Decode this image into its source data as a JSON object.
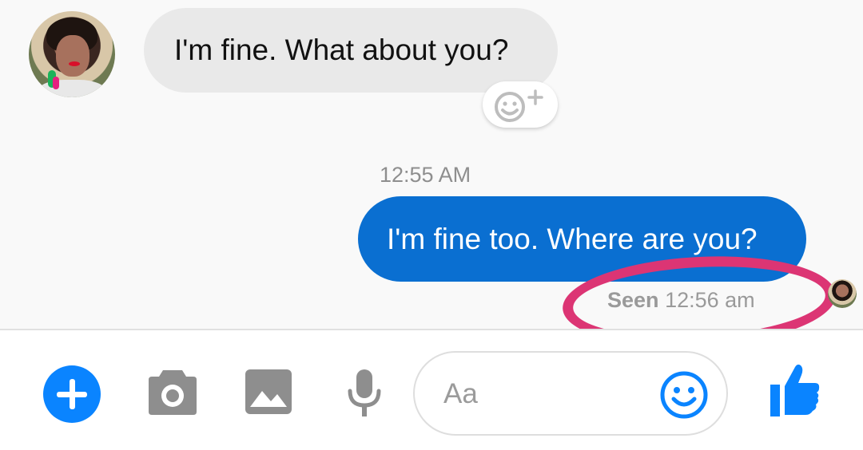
{
  "messages": {
    "incoming_text": "I'm fine. What about you?",
    "timestamp": "12:55 AM",
    "outgoing_text": "I'm fine too. Where are you?",
    "seen_label": "Seen",
    "seen_time": "12:56 am"
  },
  "composer": {
    "placeholder": "Aa"
  },
  "icons": {
    "add": "plus-circle-icon",
    "camera": "camera-icon",
    "gallery": "image-icon",
    "mic": "microphone-icon",
    "emoji": "smiley-icon",
    "like": "thumbs-up-icon",
    "react": "add-reaction-icon"
  },
  "colors": {
    "accent": "#0a84ff",
    "outgoing_bubble": "#0a6fd1",
    "incoming_bubble": "#e9e9e9",
    "highlight_ring": "#dc3574",
    "tool_gray": "#8e8e8e"
  }
}
